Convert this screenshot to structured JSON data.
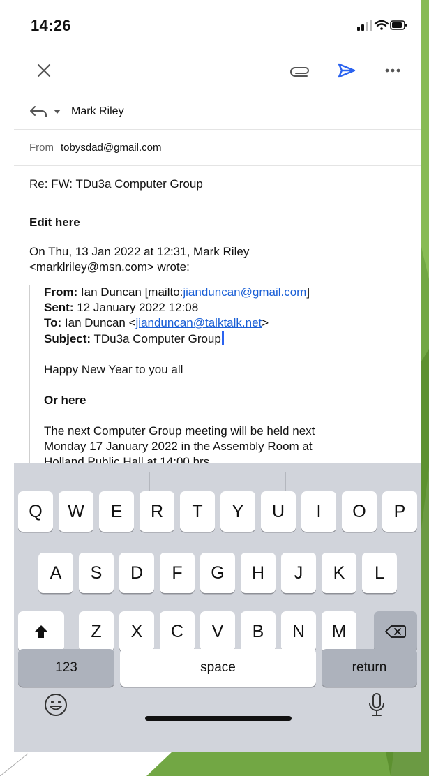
{
  "status": {
    "time": "14:26"
  },
  "compose": {
    "reply_to": "Mark Riley",
    "from_label": "From",
    "from_value": "tobysdad@gmail.com",
    "subject": "Re: FW: TDu3a Computer Group"
  },
  "body": {
    "edit_here": "Edit here",
    "intro_line1": "On Thu, 13 Jan 2022 at 12:31, Mark Riley",
    "intro_line2": "<marklriley@msn.com> wrote:",
    "quote": {
      "from_label": "From:",
      "from_text": "Ian Duncan [mailto:",
      "from_link": "jianduncan@gmail.com",
      "from_end": "]",
      "sent_label": "Sent:",
      "sent_text": "12 January 2022 12:08",
      "to_label": "To:",
      "to_text": "Ian Duncan <",
      "to_link": "jianduncan@talktalk.net",
      "to_end": ">",
      "subject_label": "Subject:",
      "subject_text": "TDu3a Computer Group",
      "greeting": "Happy New Year to you all",
      "or_here": "Or here",
      "para_line1": "The next Computer  Group meeting will be held next",
      "para_line2": "Monday 17 January 2022 in the Assembly Room at",
      "para_line3": "Holland Public Hall at 14:00 hrs."
    }
  },
  "keyboard": {
    "row1": [
      "Q",
      "W",
      "E",
      "R",
      "T",
      "Y",
      "U",
      "I",
      "O",
      "P"
    ],
    "row2": [
      "A",
      "S",
      "D",
      "F",
      "G",
      "H",
      "J",
      "K",
      "L"
    ],
    "row3": [
      "Z",
      "X",
      "C",
      "V",
      "B",
      "N",
      "M"
    ],
    "numbers_label": "123",
    "space_label": "space",
    "return_label": "return"
  },
  "colors": {
    "accent": "#2b63f0",
    "link": "#1a5fd6",
    "keyboard_bg": "#d1d4db",
    "slide_green": "#6aa23a"
  }
}
